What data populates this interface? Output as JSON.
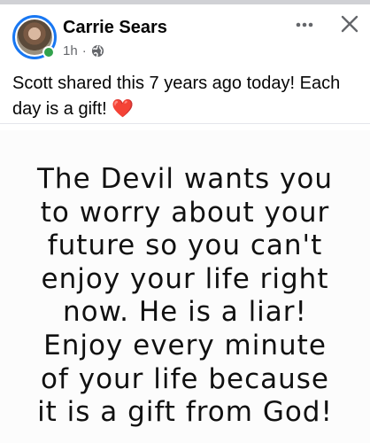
{
  "post": {
    "author": "Carrie Sears",
    "time": "1h",
    "separator": "·",
    "audience_icon": "globe-icon",
    "caption": "Scott shared this 7 years ago today! Each day is a gift!",
    "caption_emoji": "❤️",
    "image_text": "The Devil wants you\nto worry about your\nfuture so you can't\nenjoy your life right\nnow. He is a liar!\nEnjoy every minute\nof your life because\nit is a gift from God!"
  },
  "colors": {
    "online": "#31a24c",
    "avatar_ring": "#1877f2",
    "meta_text": "#65676b",
    "heart": "#e0211b"
  },
  "icons": {
    "more": "more-horizontal-icon",
    "close": "close-icon"
  }
}
